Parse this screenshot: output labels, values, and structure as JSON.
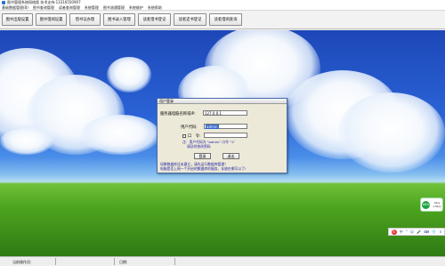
{
  "window": {
    "title": "图书管理系统网络版 技术支持:13316550907"
  },
  "menu": [
    "基础数据管理(B)",
    "图书查询管理",
    "读者查询管理",
    "系统管理",
    "图书流通管理",
    "系统维护",
    "系统帮助"
  ],
  "toolbar": {
    "buttons": [
      "图书出版设置",
      "图书借阅设置",
      "借书证办理",
      "图书录入管理",
      "读者借书登记",
      "读者还书登记",
      "读者借阅查询"
    ]
  },
  "login": {
    "title": "用户登录",
    "server_label": "服务器电脑名称或IP:",
    "server_value": "127.0.0.1",
    "user_label": "用户代码:",
    "user_value": "admin",
    "password_label": "口　令:",
    "password_value": "",
    "hint_line1": "注：用户代码为 \"admin\" 口令 \"1\"",
    "hint_line2": "请及时修改密码",
    "ok_label": "登录",
    "cancel_label": "退出",
    "footer_line1": "如果数据库还未建立，请先运行数据库管理！",
    "footer_line2": "电脑是否上网一个开启的数据库的服务，存放在哪可以了!"
  },
  "status": {
    "operator_label": "当前操作员:",
    "date_label": "日期:"
  },
  "tray": {
    "speed_value": "66%",
    "speed_line1": "0K/s",
    "speed_line2": "1.8K/s",
    "ime_logo": "S",
    "ime_items": [
      "中",
      "°",
      "☺",
      "🎤",
      "⌨",
      "👕",
      "⠿"
    ]
  },
  "colors": {
    "sky_top": "#1d47b8",
    "grass": "#4ea51f",
    "dialog_bg": "#ece9d8",
    "selection": "#3366cc",
    "link_blue": "#1a1aa0"
  }
}
